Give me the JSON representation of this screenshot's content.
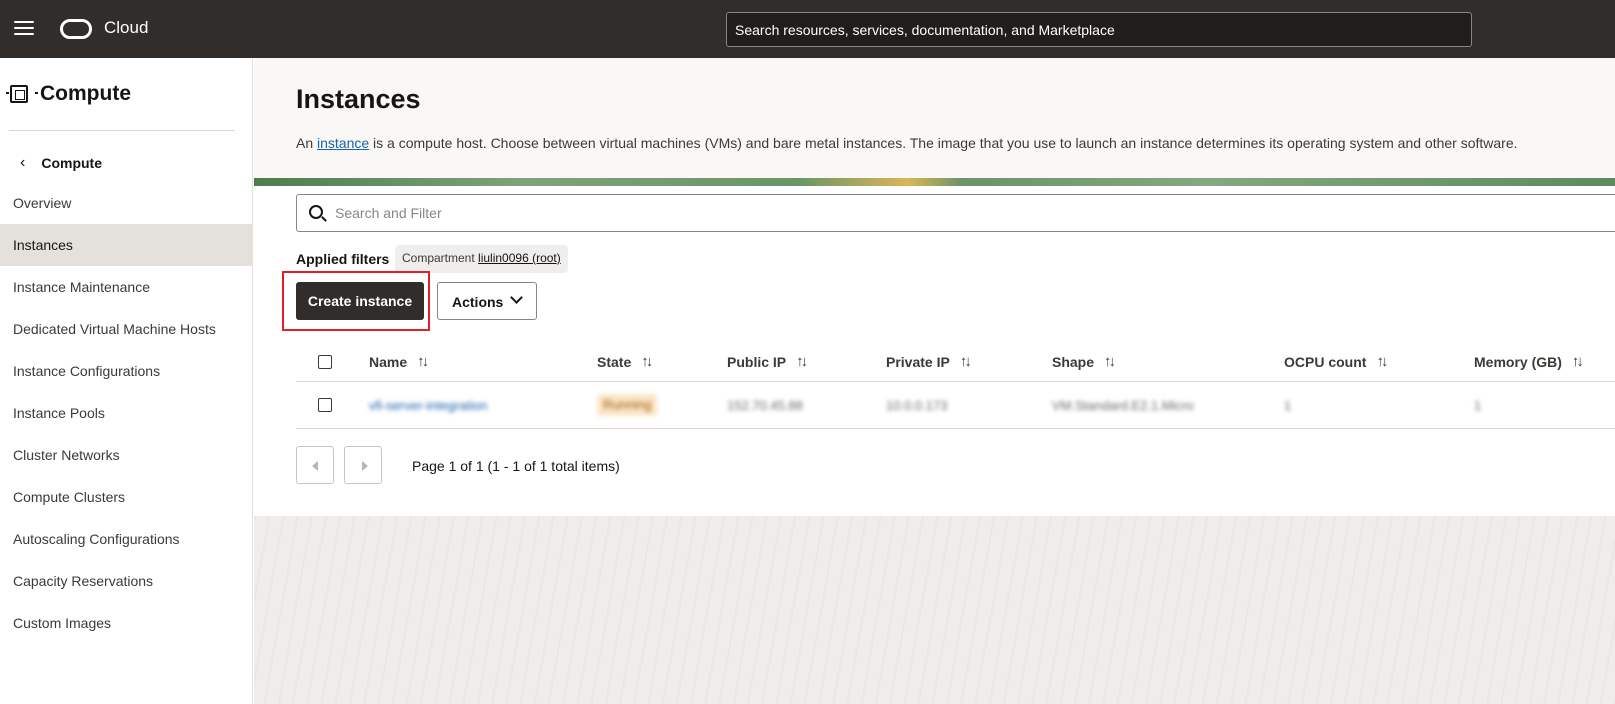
{
  "topbar": {
    "brand": "Cloud",
    "search_placeholder": "Search resources, services, documentation, and Marketplace"
  },
  "sidebar": {
    "title": "Compute",
    "back_label": "Compute",
    "items": [
      {
        "label": "Overview"
      },
      {
        "label": "Instances"
      },
      {
        "label": "Instance Maintenance"
      },
      {
        "label": "Dedicated Virtual Machine Hosts"
      },
      {
        "label": "Instance Configurations"
      },
      {
        "label": "Instance Pools"
      },
      {
        "label": "Cluster Networks"
      },
      {
        "label": "Compute Clusters"
      },
      {
        "label": "Autoscaling Configurations"
      },
      {
        "label": "Capacity Reservations"
      },
      {
        "label": "Custom Images"
      }
    ],
    "active_index": 1
  },
  "main": {
    "title": "Instances",
    "desc_prefix": "An ",
    "desc_link": "instance",
    "desc_suffix": " is a compute host. Choose between virtual machines (VMs) and bare metal instances. The image that you use to launch an instance determines its operating system and other software.",
    "filter_placeholder": "Search and Filter",
    "applied_filters_label": "Applied filters",
    "chip_prefix": "Compartment",
    "chip_value": "liulin0096 (root)",
    "create_button": "Create instance",
    "actions_button": "Actions",
    "columns": [
      "Name",
      "State",
      "Public IP",
      "Private IP",
      "Shape",
      "OCPU count",
      "Memory (GB)"
    ],
    "rows": [
      {
        "name": "vfi-server-integration",
        "state": "Running",
        "public_ip": "152.70.45.88",
        "private_ip": "10.0.0.173",
        "shape": "VM.Standard.E2.1.Micro",
        "ocpu": "1",
        "memory": "1"
      }
    ],
    "pagination": "Page 1 of 1 (1 - 1 of 1 total items)"
  },
  "colors": {
    "topbar": "#312d2a",
    "primary_button": "#312d2a",
    "link": "#1863a8",
    "highlight": "#e21f26"
  }
}
